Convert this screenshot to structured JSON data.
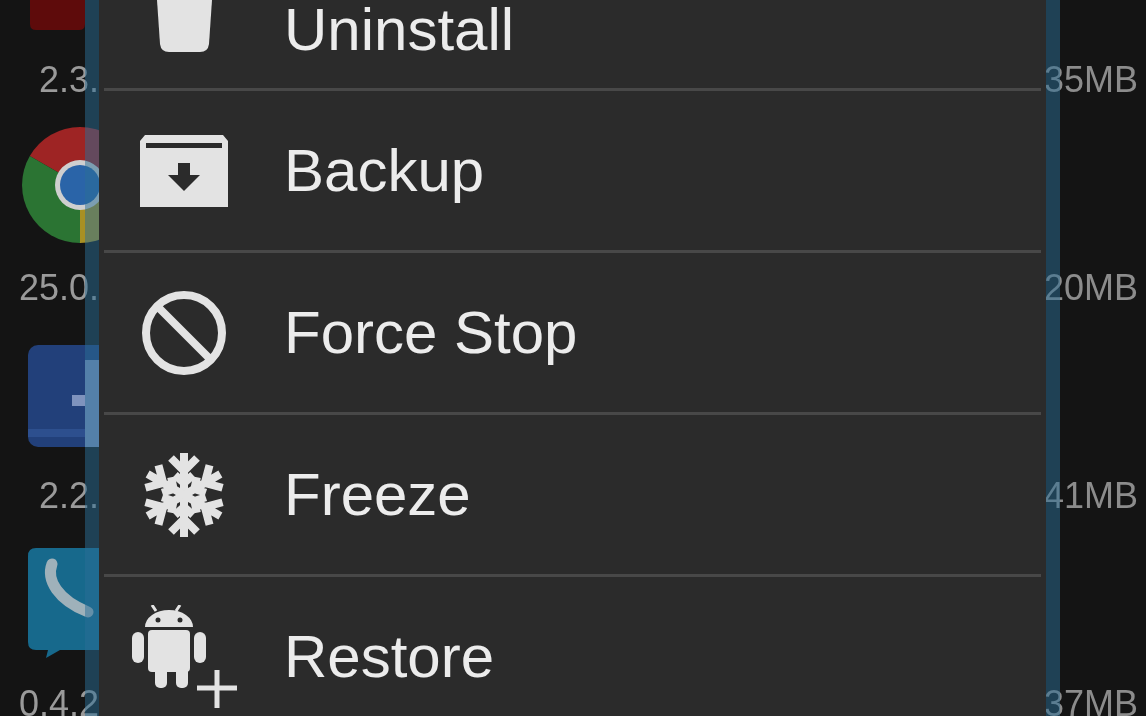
{
  "app_list": [
    {
      "version": "2.3.",
      "size": "35MB"
    },
    {
      "version": "25.0.",
      "size": "20MB"
    },
    {
      "version": "2.2.",
      "size": "41MB"
    },
    {
      "version": "0.4.2",
      "size": "37MB"
    }
  ],
  "menu": {
    "items": [
      {
        "label": "Uninstall"
      },
      {
        "label": "Backup"
      },
      {
        "label": "Force Stop"
      },
      {
        "label": "Freeze"
      },
      {
        "label": "Restore"
      }
    ]
  }
}
